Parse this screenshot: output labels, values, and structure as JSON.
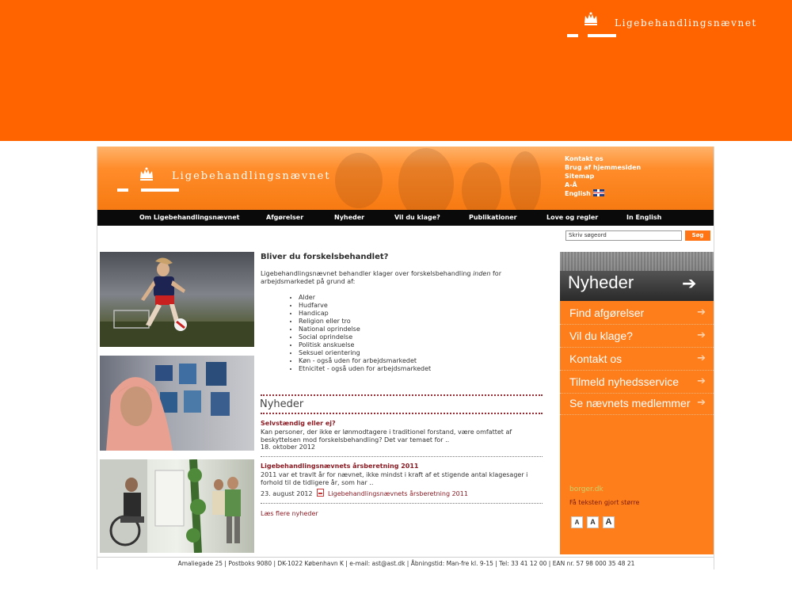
{
  "band": {
    "brand_title": "Ligebehandlingsnævnet",
    "color": "#ff6400"
  },
  "site": {
    "brand_title": "Ligebehandlingsnævnet",
    "utility_links": [
      "Kontakt os",
      "Brug af hjemmesiden",
      "Sitemap",
      "A-Å",
      "English"
    ],
    "nav": [
      "Om Ligebehandlingsnævnet",
      "Afgørelser",
      "Nyheder",
      "Vil du klage?",
      "Publikationer",
      "Love og regler",
      "In English"
    ],
    "search": {
      "placeholder": "Skriv søgeord",
      "button": "Søg"
    },
    "intro": {
      "heading": "Bliver du forskelsbehandlet?",
      "text_before": "Ligebehandlingsnævnet behandler klager over forskelsbehandling ",
      "text_em": "inden",
      "text_after": " for arbejdsmarkedet på grund af:",
      "grounds": [
        "Alder",
        "Hudfarve",
        "Handicap",
        "Religion eller tro",
        "National oprindelse",
        "Social oprindelse",
        "Politisk anskuelse",
        "Seksuel orientering",
        "Køn - også uden for arbejdsmarkedet",
        "Etnicitet - også uden for arbejdsmarkedet"
      ]
    },
    "news": {
      "heading": "Nyheder",
      "items": [
        {
          "title": "Selvstændig eller ej?",
          "text": "Kan personer, der ikke er lønmodtagere i traditionel forstand, være omfattet af beskyttelsen mod forskelsbehandling? Det var temaet for ..",
          "date": "18. oktober 2012"
        },
        {
          "title": "Ligebehandlingsnævnets årsberetning 2011",
          "text": "2011 var et travlt år for nævnet, ikke mindst i kraft af et stigende antal klagesager i forhold til de tidligere år, som har ..",
          "date": "23. august 2012",
          "attachment": "Ligebehandlingsnævnets årsberetning 2011"
        }
      ],
      "more": "Læs flere nyheder"
    },
    "sidebar": {
      "banner": "Nyheder",
      "links": [
        "Find afgørelser",
        "Vil du klage?",
        "Kontakt os",
        "Tilmeld nyhedsservice",
        "Se nævnets medlemmer"
      ],
      "borger": "borger.dk",
      "bigger_text": "Få teksten gjort større",
      "size_buttons": [
        "A",
        "A",
        "A"
      ]
    },
    "footer": "Amaliegade 25 | Postboks 9080 | DK-1022 København K | e-mail: ast@ast.dk | Åbningstid: Man-fre kl. 9-15 | Tel: 33 41 12 00 | EAN nr. 57 98 000 35 48 21"
  }
}
